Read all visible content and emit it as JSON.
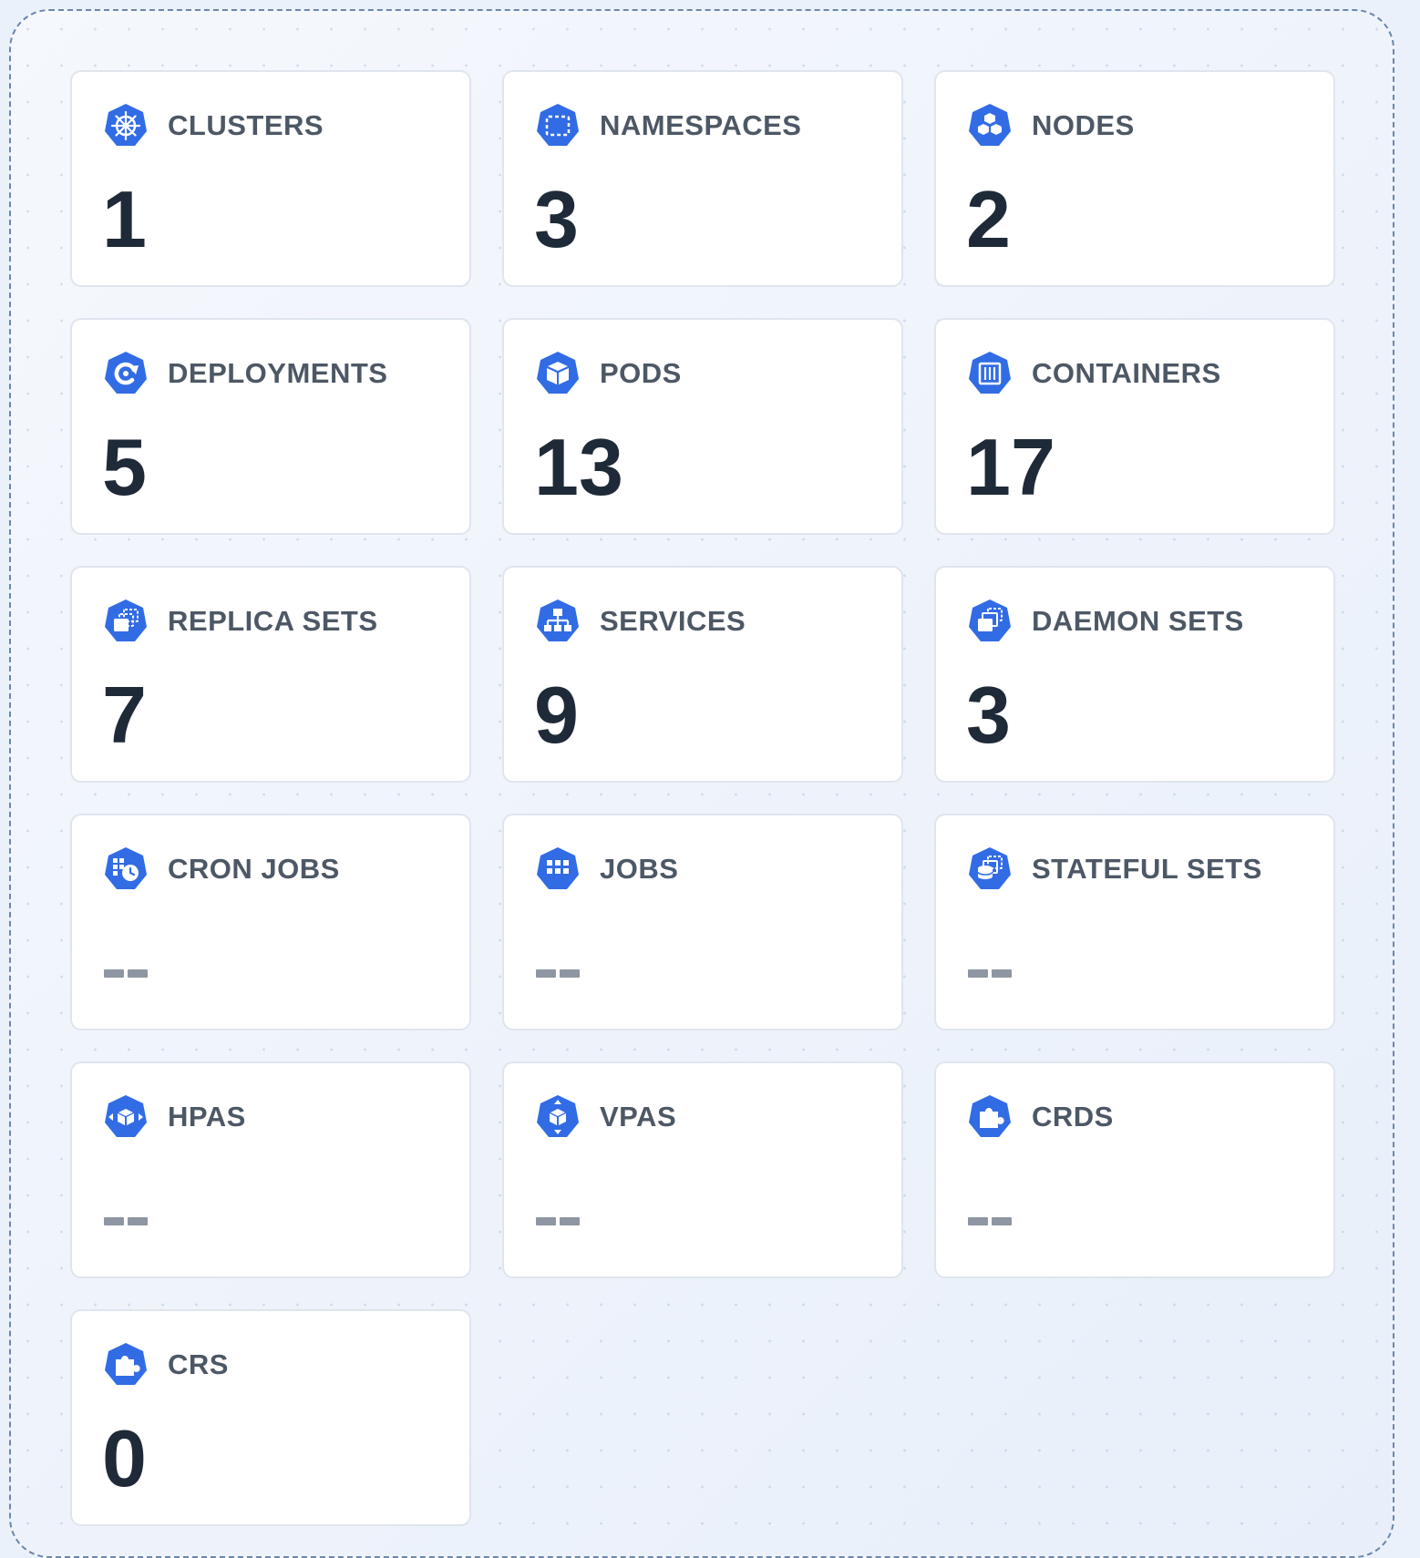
{
  "colors": {
    "accent": "#326ce5",
    "card_bg": "#ffffff",
    "label": "#4d5866",
    "value": "#1e2a37",
    "placeholder": "#8d96a2"
  },
  "cards": [
    {
      "label": "CLUSTERS",
      "value": "1",
      "icon": "kubernetes-helm-icon"
    },
    {
      "label": "NAMESPACES",
      "value": "3",
      "icon": "namespace-icon"
    },
    {
      "label": "NODES",
      "value": "2",
      "icon": "node-icon"
    },
    {
      "label": "DEPLOYMENTS",
      "value": "5",
      "icon": "deployment-icon"
    },
    {
      "label": "PODS",
      "value": "13",
      "icon": "pod-icon"
    },
    {
      "label": "CONTAINERS",
      "value": "17",
      "icon": "container-icon"
    },
    {
      "label": "REPLICA SETS",
      "value": "7",
      "icon": "replica-set-icon"
    },
    {
      "label": "SERVICES",
      "value": "9",
      "icon": "service-icon"
    },
    {
      "label": "DAEMON SETS",
      "value": "3",
      "icon": "daemon-set-icon"
    },
    {
      "label": "CRON JOBS",
      "value": null,
      "icon": "cron-job-icon"
    },
    {
      "label": "JOBS",
      "value": null,
      "icon": "job-icon"
    },
    {
      "label": "STATEFUL SETS",
      "value": null,
      "icon": "stateful-set-icon"
    },
    {
      "label": "HPAS",
      "value": null,
      "icon": "hpa-icon"
    },
    {
      "label": "VPAS",
      "value": null,
      "icon": "vpa-icon"
    },
    {
      "label": "CRDS",
      "value": null,
      "icon": "crd-icon"
    },
    {
      "label": "CRS",
      "value": "0",
      "icon": "cr-icon"
    }
  ]
}
